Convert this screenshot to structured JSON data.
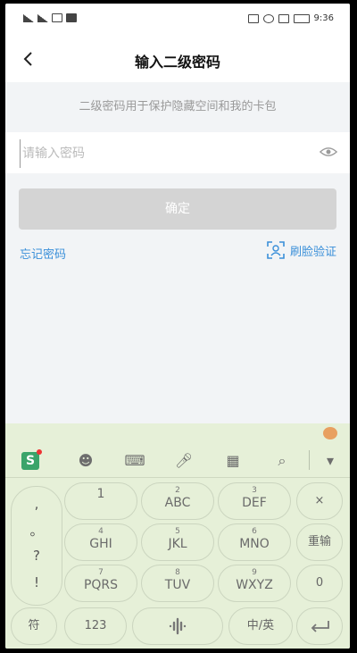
{
  "status_bar": {
    "time": "9:36"
  },
  "header": {
    "title": "输入二级密码"
  },
  "hint_text": "二级密码用于保护隐藏空间和我的卡包",
  "password_field": {
    "placeholder": "请输入密码",
    "value": ""
  },
  "confirm_button": {
    "label": "确定"
  },
  "links": {
    "forgot": "忘记密码",
    "face_verify": "刷脸验证"
  },
  "keyboard": {
    "side_symbols": [
      ",",
      "。",
      "?",
      "!"
    ],
    "keys": [
      {
        "sub": "",
        "main": "1"
      },
      {
        "sub": "2",
        "main": "ABC"
      },
      {
        "sub": "3",
        "main": "DEF"
      },
      {
        "sub": "4",
        "main": "GHI"
      },
      {
        "sub": "5",
        "main": "JKL"
      },
      {
        "sub": "6",
        "main": "MNO"
      },
      {
        "sub": "7",
        "main": "PQRS"
      },
      {
        "sub": "8",
        "main": "TUV"
      },
      {
        "sub": "9",
        "main": "WXYZ"
      }
    ],
    "delete_key": "×",
    "reset_key": "重输",
    "zero_key": "0",
    "symbol_key": "符",
    "num_key": "123",
    "lang_key": "中/英"
  },
  "colors": {
    "link": "#3a8fd9",
    "keyboard_bg": "#e6f0d8",
    "button_disabled": "#d4d4d4"
  }
}
